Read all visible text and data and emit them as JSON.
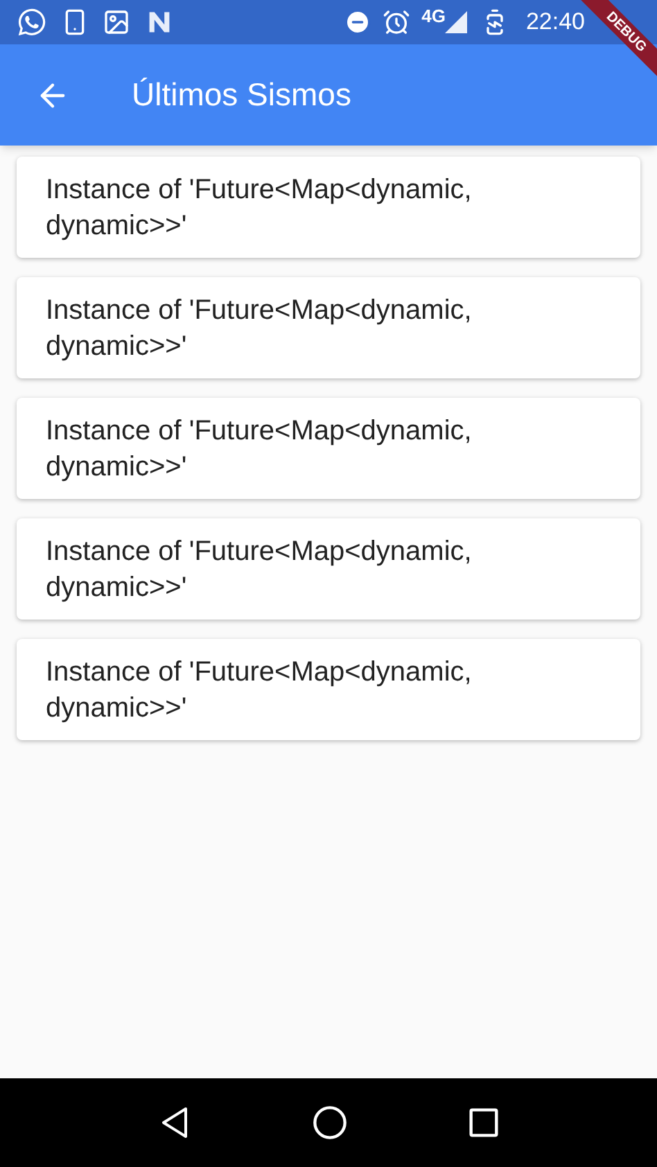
{
  "status_bar": {
    "time": "22:40",
    "network": "4G"
  },
  "debug_banner": "DEBUG",
  "app_bar": {
    "title": "Últimos Sismos"
  },
  "items": [
    {
      "text": "Instance of 'Future<Map<dynamic, dynamic>>'"
    },
    {
      "text": "Instance of 'Future<Map<dynamic, dynamic>>'"
    },
    {
      "text": "Instance of 'Future<Map<dynamic, dynamic>>'"
    },
    {
      "text": "Instance of 'Future<Map<dynamic, dynamic>>'"
    },
    {
      "text": "Instance of 'Future<Map<dynamic, dynamic>>'"
    }
  ]
}
